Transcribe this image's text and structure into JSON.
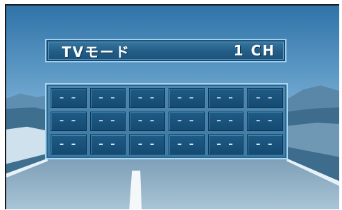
{
  "mode_bar": {
    "mode_label": "TVモード",
    "channel": "1 CH"
  },
  "channel_grid": {
    "rows": [
      [
        "– –",
        "– –",
        "– –",
        "– –",
        "– –",
        "– –"
      ],
      [
        "– –",
        "– –",
        "– –",
        "– –",
        "– –",
        "– –"
      ],
      [
        "– –",
        "– –",
        "– –",
        "– –",
        "– –",
        "– –"
      ]
    ]
  },
  "colors": {
    "panel": "#3b7aa3",
    "cell": "#1e5b85",
    "frame": "#a9d6f0"
  }
}
